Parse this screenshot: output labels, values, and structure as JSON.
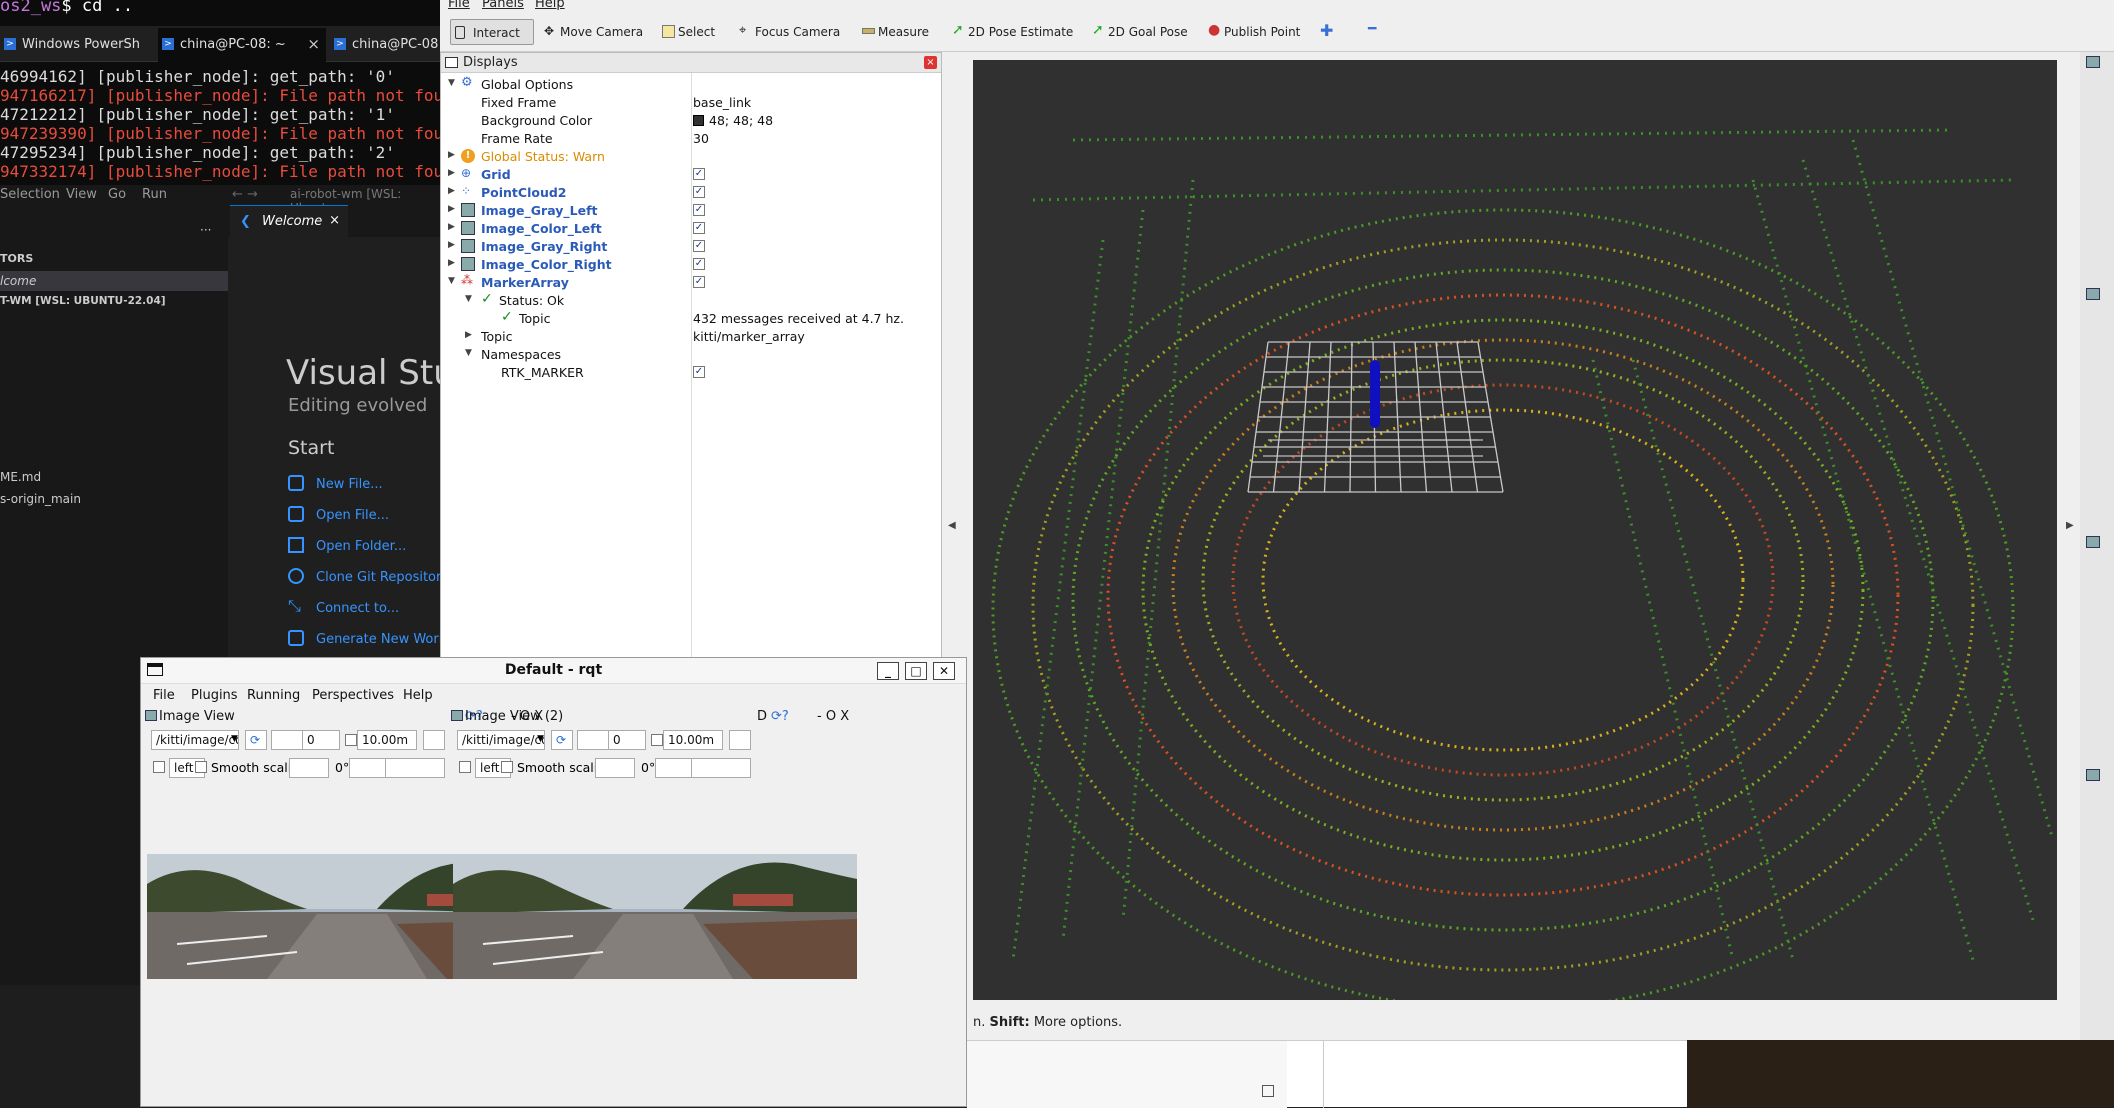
{
  "terminal": {
    "prompt_ws": "os2_ws",
    "prompt_cmd": "$ cd ..",
    "tabs": [
      {
        "label": "Windows PowerSh",
        "active": false
      },
      {
        "label": "china@PC-08: ~",
        "active": true
      },
      {
        "label": "china@PC-08",
        "active": false
      }
    ],
    "lines": [
      {
        "text": "46994162] [publisher_node]: get_path: '0'",
        "error": false
      },
      {
        "text": "947166217] [publisher_node]: File path not found",
        "error": true
      },
      {
        "text": "47212212] [publisher_node]: get_path: '1'",
        "error": false
      },
      {
        "text": "947239390] [publisher_node]: File path not found",
        "error": true
      },
      {
        "text": "47295234] [publisher_node]: get_path: '2'",
        "error": false
      },
      {
        "text": "947332174] [publisher_node]: File path not found",
        "error": true
      }
    ]
  },
  "vscode": {
    "menu": [
      "Selection",
      "View",
      "Go",
      "Run"
    ],
    "title": "ai-robot-wm [WSL: Ubuntu",
    "side_header": "TORS",
    "side_items": [
      "lcome",
      "T-WM [WSL: UBUNTU-22.04]",
      "ME.md",
      "s-origin_main"
    ],
    "more": "···",
    "tab_label": "Welcome",
    "heading": "Visual Stu",
    "subheading": "Editing evolved",
    "start": "Start",
    "links": [
      "New File...",
      "Open File...",
      "Open Folder...",
      "Clone Git Repository",
      "Connect to...",
      "Generate New Work"
    ]
  },
  "rviz": {
    "menu": [
      "File",
      "Panels",
      "Help"
    ],
    "tools": [
      "Interact",
      "Move Camera",
      "Select",
      "Focus Camera",
      "Measure",
      "2D Pose Estimate",
      "2D Goal Pose",
      "Publish Point"
    ],
    "displays_title": "Displays",
    "rows": {
      "global_options": "Global Options",
      "fixed_frame": "Fixed Frame",
      "fixed_frame_val": "base_link",
      "bg_color": "Background Color",
      "bg_color_val": "48; 48; 48",
      "frame_rate": "Frame Rate",
      "frame_rate_val": "30",
      "global_status": "Global Status: Warn",
      "grid": "Grid",
      "pointcloud": "PointCloud2",
      "img1": "Image_Gray_Left",
      "img2": "Image_Color_Left",
      "img3": "Image_Gray_Right",
      "img4": "Image_Color_Right",
      "marker": "MarkerArray",
      "status_ok": "Status: Ok",
      "topic_status": "Topic",
      "topic_status_val": "432 messages received at 4.7 hz.",
      "topic": "Topic",
      "topic_val": "kitti/marker_array",
      "namespaces": "Namespaces",
      "rtk": "RTK_MARKER"
    },
    "bg_color_hex": "#303030",
    "status_bar_bold": "Shift:",
    "status_bar_prefix": "n.",
    "status_bar_text": "More options."
  },
  "rqt": {
    "title": "Default - rqt",
    "menu": [
      "File",
      "Plugins",
      "Running",
      "Perspectives",
      "Help"
    ],
    "panes": [
      {
        "title": "Image View",
        "topic": "/kitti/image/col",
        "num": "0",
        "dist": "10.00m",
        "left": "left",
        "smooth": "Smooth scaling",
        "deg": "0°",
        "ctrl": "D",
        "ctrl2": "- O X"
      },
      {
        "title": "Image View (2)",
        "topic": "/kitti/image/col",
        "num": "0",
        "dist": "10.00m",
        "left": "left",
        "smooth": "Smooth scaling",
        "deg": "0°",
        "ctrl": "D",
        "ctrl2": "- O X"
      }
    ]
  }
}
